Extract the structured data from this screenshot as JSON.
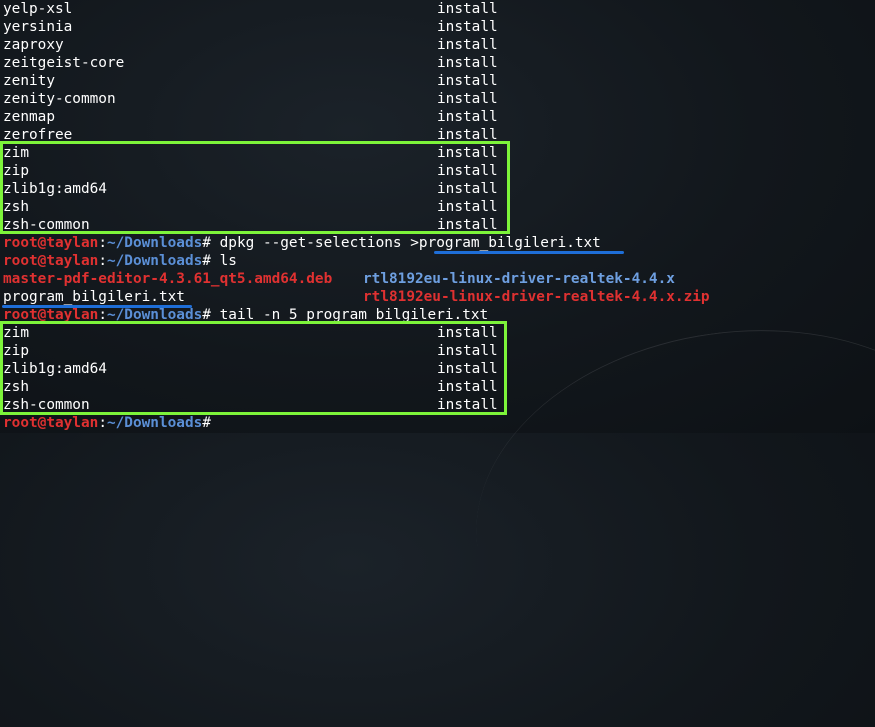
{
  "colors": {
    "background": "#12171c",
    "text": "#ffffff",
    "prompt_user": "#e03131",
    "prompt_path": "#5b8fd6",
    "highlight_box": "#7df43a",
    "underline": "#1e6ed8"
  },
  "packages_top": [
    {
      "name": "yelp-xsl",
      "state": "install"
    },
    {
      "name": "yersinia",
      "state": "install"
    },
    {
      "name": "zaproxy",
      "state": "install"
    },
    {
      "name": "zeitgeist-core",
      "state": "install"
    },
    {
      "name": "zenity",
      "state": "install"
    },
    {
      "name": "zenity-common",
      "state": "install"
    },
    {
      "name": "zenmap",
      "state": "install"
    },
    {
      "name": "zerofree",
      "state": "install"
    },
    {
      "name": "zim",
      "state": "install"
    },
    {
      "name": "zip",
      "state": "install"
    },
    {
      "name": "zlib1g:amd64",
      "state": "install"
    },
    {
      "name": "zsh",
      "state": "install"
    },
    {
      "name": "zsh-common",
      "state": "install"
    }
  ],
  "prompt": {
    "user_host": "root@taylan",
    "colon": ":",
    "path": "~/Downloads",
    "symbol": "# "
  },
  "commands": {
    "cmd1": "dpkg --get-selections >",
    "cmd1_file": "program_bilgileri.txt",
    "cmd2": "ls",
    "cmd3_prefix": "tail -n 5 ",
    "cmd3_file": "program_bilgileri.txt"
  },
  "ls_output": {
    "deb_file": "master-pdf-editor-4.3.61_qt5.amd64.deb",
    "txt_file": "program_bilgileri.txt",
    "dir": "rtl8192eu-linux-driver-realtek-4.4.x",
    "zip_file": "rtl8192eu-linux-driver-realtek-4.4.x.zip"
  },
  "packages_tail": [
    {
      "name": "zim",
      "state": "install"
    },
    {
      "name": "zip",
      "state": "install"
    },
    {
      "name": "zlib1g:amd64",
      "state": "install"
    },
    {
      "name": "zsh",
      "state": "install"
    },
    {
      "name": "zsh-common",
      "state": "install"
    }
  ]
}
